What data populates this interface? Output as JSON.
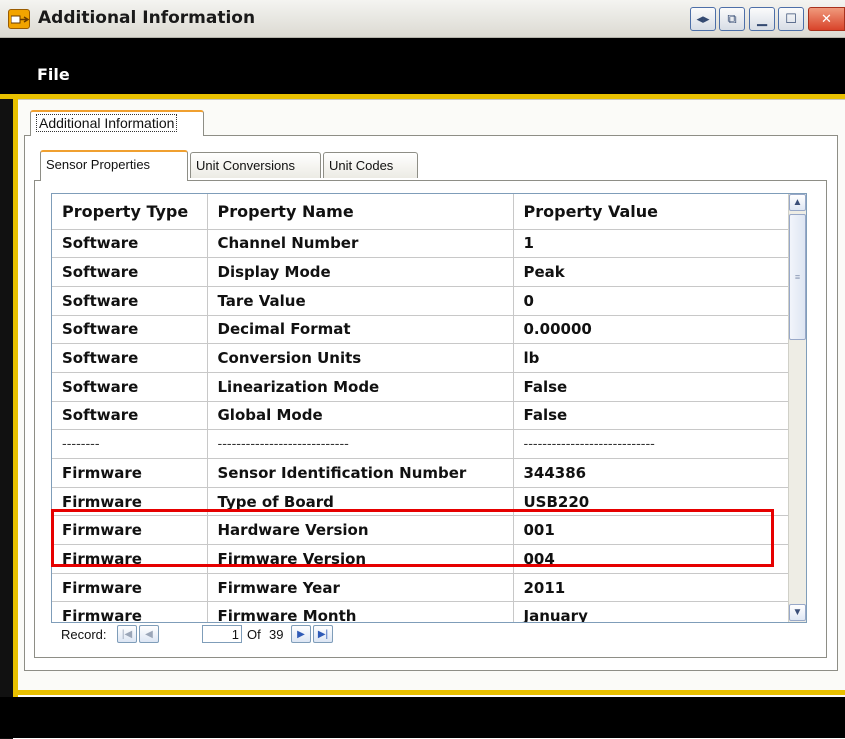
{
  "window": {
    "title": "Additional Information",
    "controls": [
      "restore-split",
      "detach",
      "minimize",
      "maximize",
      "close"
    ]
  },
  "menu": {
    "file": "File"
  },
  "outer_tab": {
    "label": "Additional Information"
  },
  "inner_tabs": [
    {
      "label": "Sensor Properties",
      "active": true
    },
    {
      "label": "Unit Conversions",
      "active": false
    },
    {
      "label": "Unit Codes",
      "active": false
    }
  ],
  "grid": {
    "columns": [
      "Property Type",
      "Property Name",
      "Property Value"
    ],
    "rows": [
      [
        "Software",
        "Channel Number",
        "1"
      ],
      [
        "Software",
        "Display Mode",
        "Peak"
      ],
      [
        "Software",
        "Tare Value",
        "0"
      ],
      [
        "Software",
        "Decimal Format",
        "0.00000"
      ],
      [
        "Software",
        "Conversion Units",
        "lb"
      ],
      [
        "Software",
        "Linearization Mode",
        "False"
      ],
      [
        "Software",
        "Global Mode",
        "False"
      ],
      [
        "--------",
        "----------------------------",
        "----------------------------"
      ],
      [
        "Firmware",
        "Sensor  Identification Number",
        "344386"
      ],
      [
        "Firmware",
        "Type of Board",
        "USB220"
      ],
      [
        "Firmware",
        "Hardware Version",
        "001"
      ],
      [
        "Firmware",
        "Firmware Version",
        "004"
      ],
      [
        "Firmware",
        "Firmware Year",
        "2011"
      ],
      [
        "Firmware",
        "Firmware Month",
        "January"
      ]
    ],
    "highlighted_rows": [
      10,
      11
    ],
    "highlight_color": "#e60000"
  },
  "navigator": {
    "label": "Record:",
    "current": "1",
    "of_label": "Of",
    "total": "39"
  },
  "colors": {
    "accent_gold": "#e8c000",
    "tab_accent": "#f0a030"
  }
}
